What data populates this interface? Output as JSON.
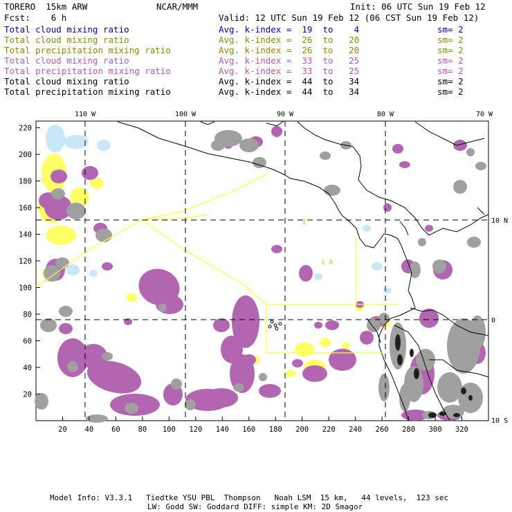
{
  "header": {
    "model": "TORERO  15km ARW",
    "center": "NCAR/MMM",
    "init": "Init: 06 UTC Sun 19 Feb 12",
    "fcst": "Fcst:    6 h",
    "valid": "Valid: 12 UTC Sun 19 Feb 12 (06 CST Sun 19 Feb 12)"
  },
  "legend": [
    {
      "field": "Total cloud mixing ratio",
      "index": "Avg. k-index =  19  to    4",
      "sm": "sm= 2",
      "color": "#0000c0"
    },
    {
      "field": "Total cloud mixing ratio",
      "index": "Avg. k-index =  26  to   20",
      "sm": "sm= 2",
      "color": "#8a8a00"
    },
    {
      "field": "Total precipitation mixing ratio",
      "index": "Avg. k-index =  26  to   20",
      "sm": "sm= 2",
      "color": "#8a8a00"
    },
    {
      "field": "Total cloud mixing ratio",
      "index": "Avg. k-index =  33  to   25",
      "sm": "sm= 2",
      "color": "#b25ab2"
    },
    {
      "field": "Total precipitation mixing ratio",
      "index": "Avg. k-index =  33  to   25",
      "sm": "sm= 2",
      "color": "#b25ab2"
    },
    {
      "field": "Total cloud mixing ratio",
      "index": "Avg. k-index =  44  to   34",
      "sm": "sm= 2",
      "color": "#000000"
    },
    {
      "field": "Total precipitation mixing ratio",
      "index": "Avg. k-index =  44  to   34",
      "sm": "sm= 2",
      "color": "#000000"
    }
  ],
  "map": {
    "lon_labels": [
      "110 W",
      "100 W",
      "90 W",
      "80 W",
      "70 W"
    ],
    "lat_labels": [
      "10 N",
      "0",
      "10 S"
    ],
    "x_ticks": [
      "20",
      "40",
      "60",
      "80",
      "100",
      "120",
      "140",
      "160",
      "180",
      "200",
      "220",
      "240",
      "260",
      "280",
      "300",
      "320"
    ],
    "y_ticks": [
      "20",
      "40",
      "60",
      "80",
      "100",
      "120",
      "140",
      "160",
      "180",
      "200",
      "220"
    ],
    "region_label_1": "I",
    "region_label_2": "C R",
    "colors": {
      "light_blue": "#c8e8f8",
      "yellow": "#ffff66",
      "purple": "#b266b2",
      "gray": "#a0a0a0",
      "dark": "#202020",
      "coast": "#000000",
      "boundary": "#ffff33"
    }
  },
  "footer": {
    "line1": "Model Info: V3.3.1   Tiedtke YSU PBL  Thompson   Noah LSM  15 km,   44 levels,  123 sec",
    "line2": "LW: Godd SW: Goddard DIFF: simple KM: 2D Smagor"
  }
}
